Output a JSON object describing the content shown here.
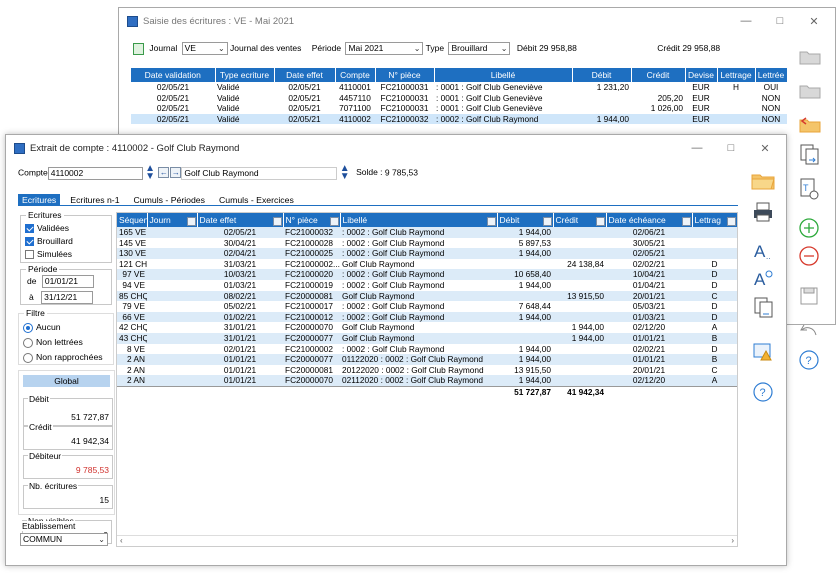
{
  "bg": {
    "title": "Saisie des écritures : VE - Mai 2021",
    "journal_label": "Journal",
    "journal_value": "VE",
    "journal_name": "Journal des ventes",
    "periode_label": "Période",
    "periode_value": "Mai 2021",
    "type_label": "Type",
    "type_value": "Brouillard",
    "debit_label": "Débit",
    "debit_value": "29 958,88",
    "credit_label": "Crédit",
    "credit_value": "29 958,88",
    "columns": [
      "Date validation",
      "Type ecriture",
      "Date effet",
      "Compte",
      "N° pièce",
      "Libellé",
      "Débit",
      "Crédit",
      "Devise",
      "Lettrage",
      "Lettrée"
    ],
    "rows": [
      [
        "02/05/21",
        "Validé",
        "02/05/21",
        "4110001",
        "FC21000031",
        ": 0001 : Golf Club Geneviève",
        "1 231,20",
        "",
        "EUR",
        "H",
        "OUI"
      ],
      [
        "02/05/21",
        "Validé",
        "02/05/21",
        "4457110",
        "FC21000031",
        ": 0001 : Golf Club Geneviève",
        "",
        "205,20",
        "EUR",
        "",
        "NON"
      ],
      [
        "02/05/21",
        "Validé",
        "02/05/21",
        "7071100",
        "FC21000031",
        ": 0001 : Golf Club Geneviève",
        "",
        "1 026,00",
        "EUR",
        "",
        "NON"
      ],
      [
        "02/05/21",
        "Validé",
        "02/05/21",
        "4110002",
        "FC21000032",
        ": 0002 : Golf Club Raymond",
        "1 944,00",
        "",
        "EUR",
        "",
        "NON"
      ]
    ]
  },
  "fg": {
    "title": "Extrait de compte : 4110002 - Golf Club Raymond",
    "compte_label": "Compte",
    "compte_value": "4110002",
    "compte_name": "Golf Club Raymond",
    "solde_label": "Solde :",
    "solde_value": "9 785,53",
    "tabs": [
      "Ecritures",
      "Ecritures n-1",
      "Cumuls - Périodes",
      "Cumuls - Exercices"
    ],
    "filters": {
      "ecritures_label": "Ecritures",
      "validees": "Validées",
      "brouillard": "Brouillard",
      "simulees": "Simulées",
      "periode_label": "Période",
      "de_label": "de",
      "de_value": "01/01/21",
      "a_label": "à",
      "a_value": "31/12/21",
      "filtre_label": "Filtre",
      "aucun": "Aucun",
      "non_lettrees": "Non lettrées",
      "non_rapprochees": "Non rapprochées",
      "global_label": "Global",
      "debit_label": "Débit",
      "debit_value": "51 727,87",
      "credit_label": "Crédit",
      "credit_value": "41 942,34",
      "debiteur_label": "Débiteur",
      "debiteur_value": "9 785,53",
      "nb_label": "Nb. écritures",
      "nb_value": "15",
      "nonvis_label": "Non visibles",
      "nonvis_value": "0",
      "etab_label": "Etablissement",
      "etab_value": "COMMUN"
    },
    "columns": [
      "Séquen",
      "Journ",
      "Date effet",
      "N° pièce",
      "Libellé",
      "Débit",
      "Crédit",
      "Date échéance",
      "Lettrag"
    ],
    "rows": [
      [
        "165 VE",
        "",
        "02/05/21",
        "FC21000032",
        ": 0002 : Golf Club Raymond",
        "1 944,00",
        "",
        "02/06/21",
        ""
      ],
      [
        "145 VE",
        "",
        "30/04/21",
        "FC21000028",
        ": 0002 : Golf Club Raymond",
        "5 897,53",
        "",
        "30/05/21",
        ""
      ],
      [
        "130 VE",
        "",
        "02/04/21",
        "FC21000025",
        ": 0002 : Golf Club Raymond",
        "1 944,00",
        "",
        "02/05/21",
        ""
      ],
      [
        "121 CHQ",
        "",
        "31/03/21",
        "FC21000002...",
        "Golf Club Raymond",
        "",
        "24 138,84",
        "02/02/21",
        "D"
      ],
      [
        "97 VE",
        "",
        "10/03/21",
        "FC21000020",
        ": 0002 : Golf Club Raymond",
        "10 658,40",
        "",
        "10/04/21",
        "D"
      ],
      [
        "94 VE",
        "",
        "01/03/21",
        "FC21000019",
        ": 0002 : Golf Club Raymond",
        "1 944,00",
        "",
        "01/04/21",
        "D"
      ],
      [
        "85 CHQ",
        "",
        "08/02/21",
        "FC20000081",
        "Golf Club Raymond",
        "",
        "13 915,50",
        "20/01/21",
        "C"
      ],
      [
        "79 VE",
        "",
        "05/02/21",
        "FC21000017",
        ": 0002 : Golf Club Raymond",
        "7 648,44",
        "",
        "05/03/21",
        "D"
      ],
      [
        "66 VE",
        "",
        "01/02/21",
        "FC21000012",
        ": 0002 : Golf Club Raymond",
        "1 944,00",
        "",
        "01/03/21",
        "D"
      ],
      [
        "42 CHQ",
        "",
        "31/01/21",
        "FC20000070",
        "Golf Club Raymond",
        "",
        "1 944,00",
        "02/12/20",
        "A"
      ],
      [
        "43 CHQ",
        "",
        "31/01/21",
        "FC20000077",
        "Golf Club Raymond",
        "",
        "1 944,00",
        "01/01/21",
        "B"
      ],
      [
        "8 VE",
        "",
        "02/01/21",
        "FC21000002",
        ": 0002 : Golf Club Raymond",
        "1 944,00",
        "",
        "02/02/21",
        "D"
      ],
      [
        "2 AN",
        "",
        "01/01/21",
        "FC20000077",
        "01122020 : 0002 : Golf Club Raymond",
        "1 944,00",
        "",
        "01/01/21",
        "B"
      ],
      [
        "2 AN",
        "",
        "01/01/21",
        "FC20000081",
        "20122020 : 0002 : Golf Club Raymond",
        "13 915,50",
        "",
        "20/01/21",
        "C"
      ],
      [
        "2 AN",
        "",
        "01/01/21",
        "FC20000070",
        "02112020 : 0002 : Golf Club Raymond",
        "1 944,00",
        "",
        "02/12/20",
        "A"
      ]
    ],
    "total_debit": "51 727,87",
    "total_credit": "41 942,34"
  },
  "colors": {
    "header_blue": "#1e6fc1",
    "selected_row": "#cfe6fa",
    "icon_orange": "#e8a43a",
    "icon_green": "#2eaa3c",
    "icon_red": "#d73b2e",
    "icon_blue": "#2f7dd3",
    "debiteur_red": "#d0312d"
  }
}
